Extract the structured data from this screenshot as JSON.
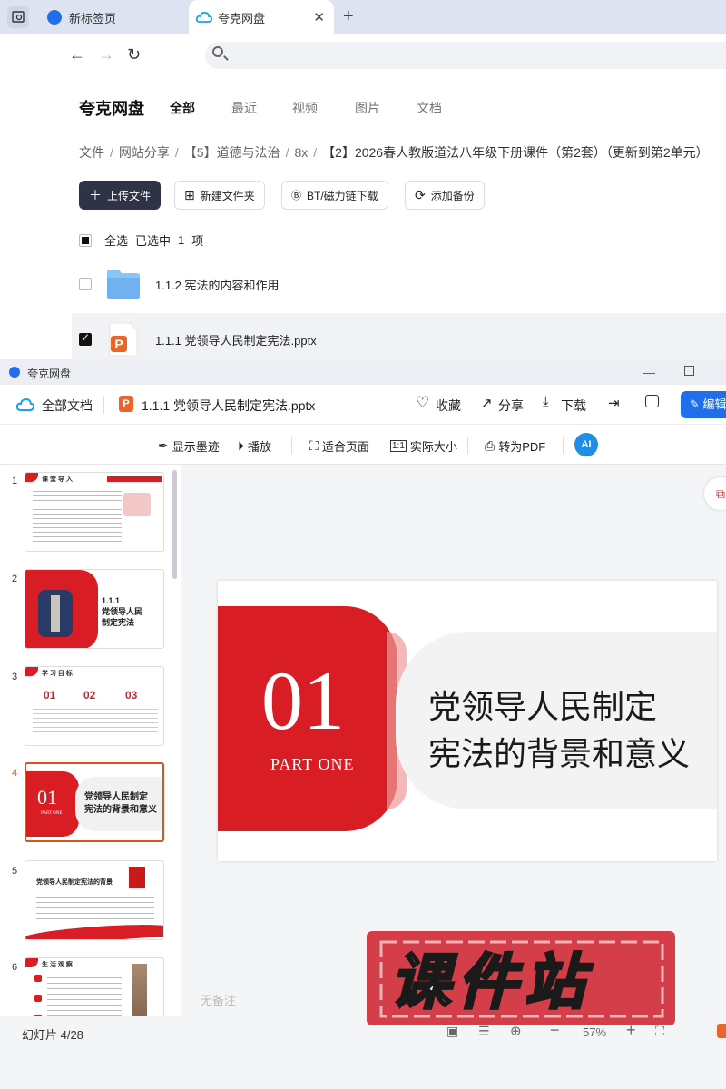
{
  "browser": {
    "tabs": [
      {
        "label": "新标签页",
        "active": false
      },
      {
        "label": "夸克网盘",
        "active": true
      }
    ],
    "url": ""
  },
  "drive": {
    "brand": "夸克网盘",
    "nav_tabs": [
      "全部",
      "最近",
      "视频",
      "图片",
      "文档"
    ],
    "breadcrumb": [
      "文件",
      "网站分享",
      "【5】道德与法治",
      "8x",
      "【2】2026春人教版道法八年级下册课件（第2套）（更新到第2单元）"
    ],
    "actions": {
      "upload": "上传文件",
      "new_folder": "新建文件夹",
      "bt": "BT/磁力链下载",
      "backup": "添加备份"
    },
    "selection": {
      "select_all": "全选",
      "selected": "已选中",
      "count": "1",
      "unit": "项"
    },
    "files": [
      {
        "name": "1.1.2 宪法的内容和作用",
        "type": "folder",
        "checked": false
      },
      {
        "name": "1.1.1 党领导人民制定宪法.pptx",
        "type": "pptx",
        "checked": true
      }
    ]
  },
  "viewer": {
    "window_title": "夸克网盘",
    "all_docs": "全部文档",
    "file_name": "1.1.1 党领导人民制定宪法.pptx",
    "actions": {
      "favorite": "收藏",
      "share": "分享",
      "download": "下载",
      "edit": "编辑"
    },
    "toolbar": {
      "show_ink": "显示墨迹",
      "play": "播放",
      "fit_page": "适合页面",
      "actual_size": "实际大小",
      "to_pdf": "转为PDF"
    },
    "thumbnails": [
      {
        "num": "1",
        "caption": "课 堂 导 入"
      },
      {
        "num": "2",
        "caption": "1.1.1\n党领导人民\n制定宪法"
      },
      {
        "num": "3",
        "caption": "学 习 目 标"
      },
      {
        "num": "4",
        "caption": "党领导人民制定\n宪法的背景和意义"
      },
      {
        "num": "5",
        "caption": "党领导人民制定宪法的背景"
      },
      {
        "num": "6",
        "caption": "生 活 观 察"
      }
    ],
    "thumb3_numbers": [
      "01",
      "02",
      "03"
    ],
    "slide": {
      "number": "01",
      "part": "PART ONE",
      "title_line1": "党领导人民制定",
      "title_line2": "宪法的背景和意义"
    },
    "notes": "无备注",
    "status": "幻灯片 4/28",
    "zoom": "57%",
    "watermark": "课件站"
  },
  "colors": {
    "accent_red": "#d81e24",
    "brand_blue": "#1f6feb",
    "dark_button": "#2f3346",
    "current_thumb": "#d9531e"
  }
}
